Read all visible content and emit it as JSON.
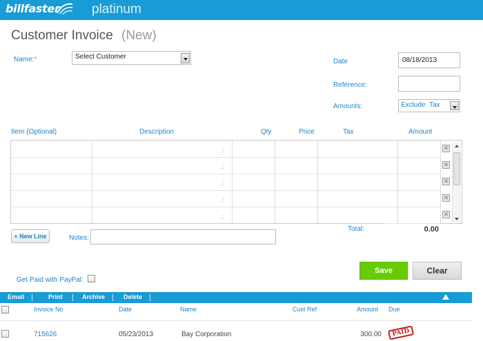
{
  "app": {
    "logo_text": "billfaster",
    "edition": "platinum"
  },
  "page": {
    "title": "Customer Invoice",
    "subtitle": "(New)"
  },
  "form": {
    "name_label": "Name:",
    "required_mark": "*",
    "customer_select": "Select Customer",
    "date_label": "Date",
    "date_value": "08/18/2013",
    "reference_label": "Reference:",
    "reference_value": "",
    "amounts_label": "Amounts:",
    "amounts_select": "Exclude  Tax"
  },
  "items_table": {
    "columns": [
      "Item (Optional)",
      "Description",
      "Qty",
      "Price",
      "Tax",
      "Amount"
    ],
    "row_count": 5,
    "row_grip_glyph": ".:",
    "row_delete_glyph": "✕"
  },
  "actions": {
    "new_line": "+ New Line",
    "notes_label": "Notes:",
    "notes_value": "",
    "total_label": "Total:",
    "total_value": "0.00",
    "paypal_label": "Get Paid with PayPal:",
    "save": "Save",
    "clear": "Clear"
  },
  "invoice_list": {
    "toolbar": [
      "Email",
      "Print",
      "Archive",
      "Delete"
    ],
    "columns": [
      "Invoice No",
      "Date",
      "Name",
      "Cust Ref",
      "Amount",
      "Due"
    ],
    "rows": [
      {
        "invoice_no": "715626",
        "date": "05/23/2013",
        "name": "Bay Corporation",
        "cust_ref": "",
        "amount": "300.00",
        "due": "PAID"
      }
    ]
  },
  "colors": {
    "brand_blue": "#199bd6",
    "link_blue": "#1f84c4",
    "save_green": "#66cc00",
    "paid_red": "#c41e1e"
  }
}
